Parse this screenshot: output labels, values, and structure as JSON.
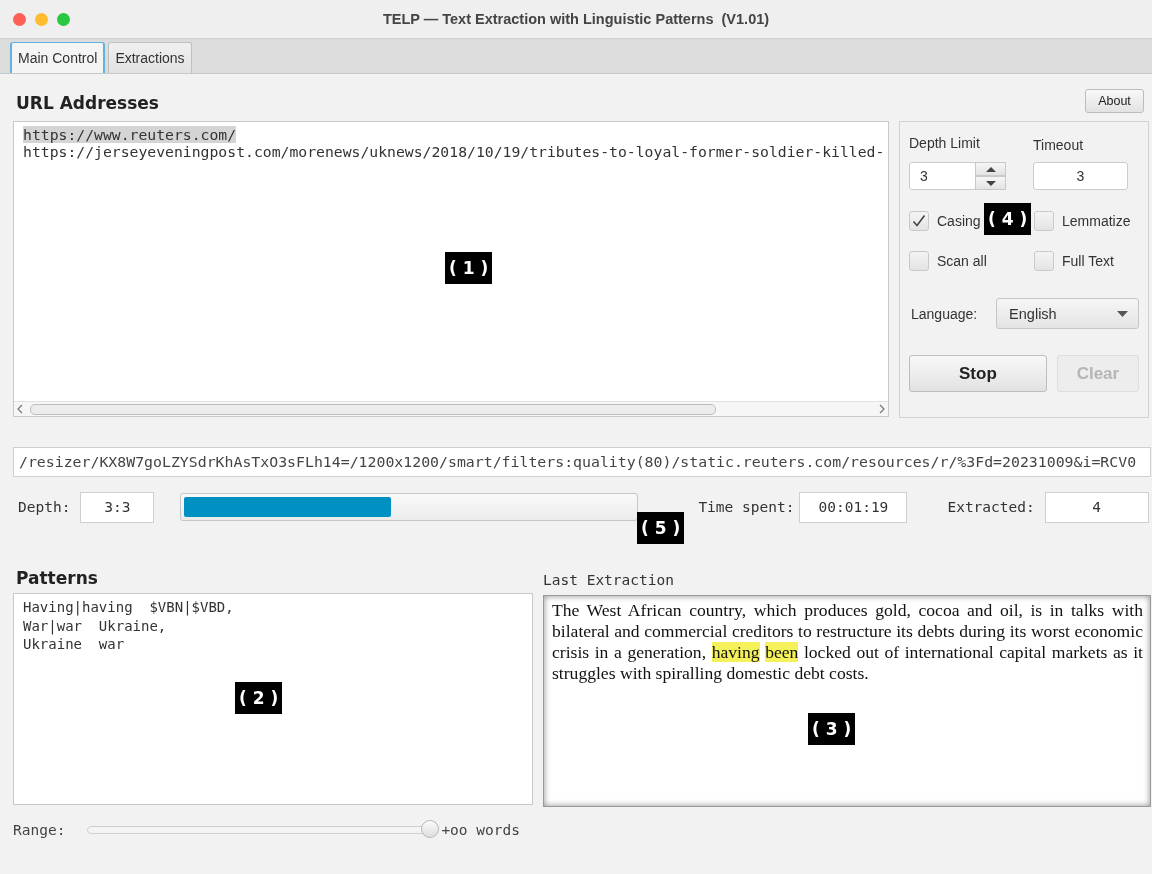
{
  "window": {
    "title": "TELP — Text Extraction with Linguistic Patterns  (V1.01)"
  },
  "tabs": [
    {
      "label": "Main Control",
      "selected": true
    },
    {
      "label": "Extractions",
      "selected": false
    }
  ],
  "url_section": {
    "heading": "URL Addresses",
    "lines": [
      {
        "text": "https://www.reuters.com/",
        "selected": true
      },
      {
        "text": "https://jerseyeveningpost.com/morenews/uknews/2018/10/19/tributes-to-loyal-former-soldier-killed-",
        "selected": false
      }
    ]
  },
  "about_button": "About",
  "settings": {
    "depth_limit": {
      "label": "Depth Limit",
      "value": "3"
    },
    "timeout": {
      "label": "Timeout",
      "value": "3"
    },
    "checkboxes": [
      {
        "label": "Casing",
        "checked": true
      },
      {
        "label": "Lemmatize",
        "checked": false
      },
      {
        "label": "Scan all",
        "checked": false
      },
      {
        "label": "Full Text",
        "checked": false
      }
    ],
    "language": {
      "label": "Language:",
      "value": "English"
    },
    "buttons": [
      {
        "label": "Stop",
        "disabled": false
      },
      {
        "label": "Clear",
        "disabled": true
      }
    ]
  },
  "current_url": "/resizer/KX8W7goLZYSdrKhAsTxO3sFLh14=/1200x1200/smart/filters:quality(80)/static.reuters.com/resources/r/%3Fd=20231009&i=RCV0",
  "status": {
    "depth_label": "Depth:",
    "depth": "3:3",
    "level": 0.46,
    "time_label": "Time spent:",
    "time": "00:01:19",
    "extracted_label": "Extracted:",
    "extracted": "4"
  },
  "patterns": {
    "heading": "Patterns",
    "lines": [
      "Having|having  $VBN|$VBD,",
      "War|war  Ukraine,",
      "Ukraine  war"
    ]
  },
  "last_extraction": {
    "heading": "Last Extraction",
    "segments": [
      {
        "text": "The West African country, which produces gold, cocoa and oil, is in talks with bilateral and commercial creditors to restructure its debts during its worst economic crisis in a generation, ",
        "highlight": false
      },
      {
        "text": "having been",
        "highlight": true
      },
      {
        "text": " locked out of international capital markets as it struggles with spiralling domestic debt costs.",
        "highlight": false
      }
    ]
  },
  "range": {
    "label": "Range:",
    "level": 1.0,
    "reading": "+oo words"
  },
  "callouts": [
    "( 1 )",
    "( 2 )",
    "( 3 )",
    "( 4 )",
    "( 5 )"
  ]
}
